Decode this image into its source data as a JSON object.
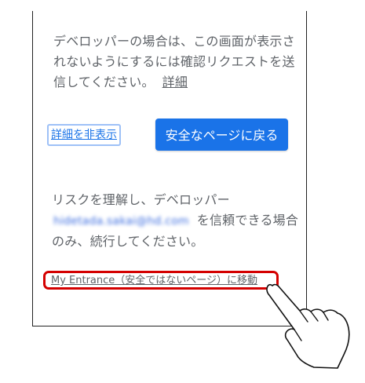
{
  "warning": {
    "developer_text": "デベロッパーの場合は、この画面が表示されないようにするには確認リクエストを送信してください。",
    "details_link": "詳細",
    "hide_details_link": "詳細を非表示",
    "back_to_safety_button": "安全なページに戻る",
    "risk_text_before": "リスクを理解し、デベロッパー",
    "developer_email": "hidetada.sakai@hd.com",
    "risk_text_after": "を信頼できる場合のみ、続行してください。",
    "proceed_link": "My Entrance（安全ではないページ）に移動"
  },
  "colors": {
    "accent_blue": "#1a73e8",
    "highlight_red": "#d40000",
    "body_text": "#5f6368"
  },
  "icons": {
    "pointer": "pointing-hand-icon"
  }
}
